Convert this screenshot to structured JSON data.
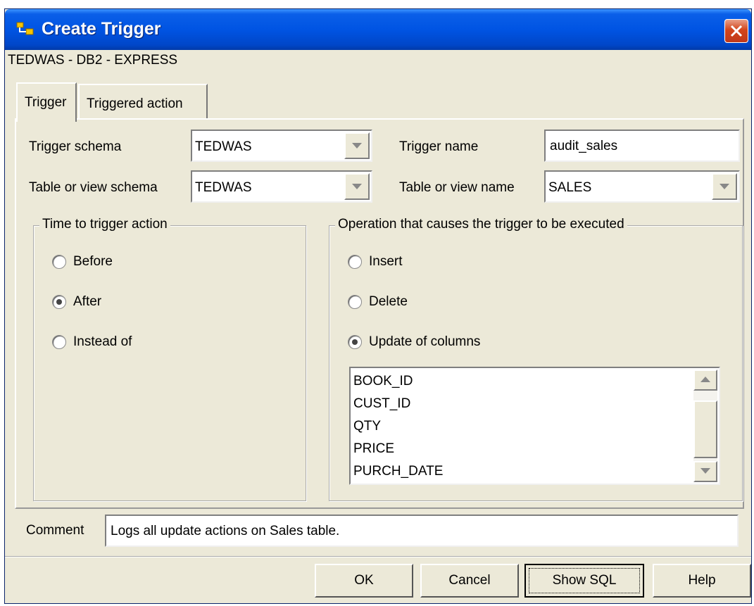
{
  "window": {
    "title": "Create Trigger",
    "subtitle": "TEDWAS - DB2 - EXPRESS"
  },
  "tabs": [
    {
      "label": "Trigger",
      "active": true
    },
    {
      "label": "Triggered action",
      "active": false
    }
  ],
  "fields": {
    "trigger_schema_label": "Trigger schema",
    "trigger_schema_value": "TEDWAS",
    "trigger_name_label": "Trigger name",
    "trigger_name_value": "audit_sales",
    "table_schema_label": "Table or view schema",
    "table_schema_value": "TEDWAS",
    "table_name_label": "Table or view name",
    "table_name_value": "SALES"
  },
  "time_group": {
    "title": "Time to trigger action",
    "options": [
      "Before",
      "After",
      "Instead of"
    ],
    "selected": "After"
  },
  "operation_group": {
    "title": "Operation that causes the trigger to be executed",
    "options": [
      "Insert",
      "Delete",
      "Update of columns"
    ],
    "selected": "Update of columns",
    "columns": [
      "BOOK_ID",
      "CUST_ID",
      "QTY",
      "PRICE",
      "PURCH_DATE"
    ]
  },
  "comment": {
    "label": "Comment",
    "value": "Logs all update actions on Sales table."
  },
  "buttons": {
    "ok": "OK",
    "cancel": "Cancel",
    "show_sql": "Show SQL",
    "help": "Help"
  },
  "colors": {
    "titlebar": "#0054e3",
    "dialog_bg": "#ece9d8",
    "close_button": "#d3451b"
  }
}
